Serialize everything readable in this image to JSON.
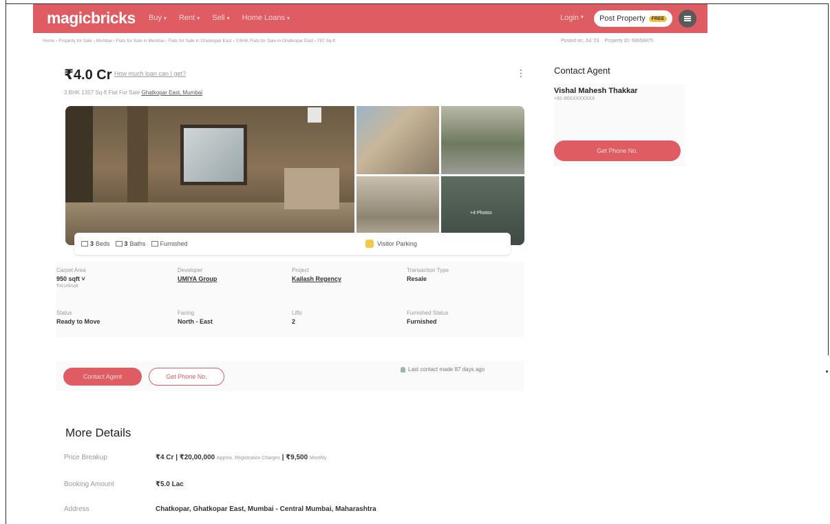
{
  "header": {
    "logo": "magicbricks",
    "nav": [
      "Buy",
      "Rent",
      "Sell",
      "Home Loans"
    ],
    "login": "Login",
    "post_property": "Post Property",
    "free_tag": "FREE"
  },
  "breadcrumb": "Home › Property for Sale › Mumbai › Flats for Sale in Mumbai › Flats for Sale in Ghatkopar East › 3 BHK Flats for Sale in Ghatkopar East › 787 Sq-ft",
  "meta": {
    "posted": "Posted on: Jul '23",
    "property_id": "Property ID: 68658875"
  },
  "listing": {
    "price": "₹4.0 Cr",
    "price_link": "How much loan can I get?",
    "subtitle_prefix": "3 BHK 1357 Sq-ft Flat For Sale",
    "location": "Ghatkopar East, Mumbai",
    "photos_count": "+4 Photos",
    "amenities": {
      "beds_value": "3",
      "beds_label": "Beds",
      "baths_value": "3",
      "baths_label": "Baths",
      "furnished": "Furnished",
      "visitor_parking": "Visitor Parking"
    },
    "specs": {
      "carpet_area_label": "Carpet Area",
      "carpet_area_value": "950 sqft",
      "carpet_area_rate": "₹42105/sqft",
      "developer_label": "Developer",
      "developer_value": "UMIYA Group",
      "project_label": "Project",
      "project_value": "Kailash Regency",
      "transaction_label": "Transaction Type",
      "transaction_value": "Resale",
      "status_label": "Status",
      "status_value": "Ready to Move",
      "facing_label": "Facing",
      "facing_value": "North - East",
      "lifts_label": "Lifts",
      "lifts_value": "2",
      "furnished_label": "Furnished Status",
      "furnished_value": "Furnished"
    },
    "actions": {
      "contact_agent": "Contact Agent",
      "get_phone": "Get Phone No.",
      "last_contact": "Last contact made 87 days ago"
    }
  },
  "sidebar": {
    "title": "Contact Agent",
    "agent_name": "Vishal Mahesh Thakkar",
    "agent_phone": "+91-88XXXXXXXX",
    "get_phone": "Get Phone No."
  },
  "more_details": {
    "title": "More Details",
    "price_breakup_label": "Price Breakup",
    "price_breakup_value": "₹4 Cr | ₹20,00,000",
    "price_breakup_note": "Approx. Registration Charges",
    "price_breakup_value2": "| ₹9,500",
    "price_breakup_note2": "Monthly",
    "booking_label": "Booking Amount",
    "booking_value": "₹5.0 Lac",
    "address_label": "Address",
    "address_value": "Chatkopar, Ghatkopar East, Mumbai - Central Mumbai, Maharashtra"
  }
}
